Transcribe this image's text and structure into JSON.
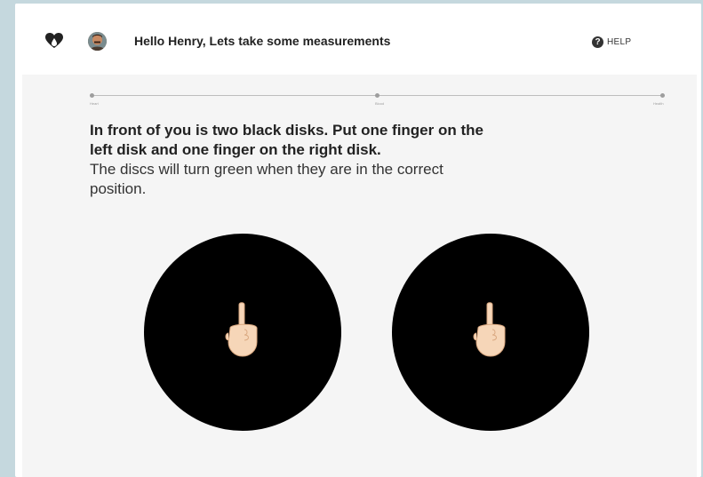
{
  "header": {
    "greeting": "Hello Henry, Lets take some measurements",
    "help_label": "HELP",
    "logo_icon": "heart-drop-icon",
    "avatar_icon": "user-avatar"
  },
  "progress": {
    "steps": [
      {
        "label": "Heart"
      },
      {
        "label": "Blood"
      },
      {
        "label": "Health"
      }
    ]
  },
  "instruction": {
    "bold_text": "In front of you is two black disks.  Put one finger on the left disk and one finger on the right disk.",
    "normal_text": "The discs will turn green when they are in the correct position."
  },
  "disks": [
    {
      "name": "left",
      "color": "#000000",
      "icon": "pointing-finger-icon"
    },
    {
      "name": "right",
      "color": "#000000",
      "icon": "pointing-finger-icon"
    }
  ],
  "colors": {
    "page_background": "#c5d8de",
    "content_background": "#f5f5f5",
    "disk": "#000000"
  }
}
